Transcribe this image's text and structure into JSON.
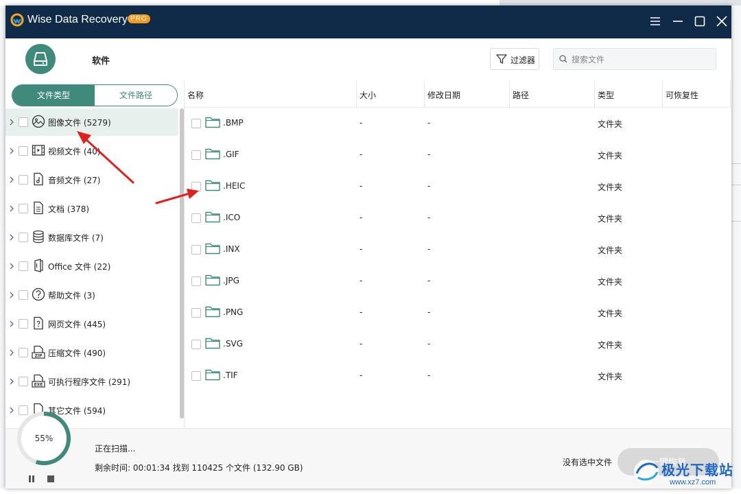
{
  "app": {
    "title": "Wise Data Recovery",
    "badge": "PRO"
  },
  "toolbar": {
    "drive_label": "软件",
    "filter_label": "过滤器",
    "search_placeholder": "搜索文件"
  },
  "sidebar": {
    "tabs": [
      {
        "label": "文件类型",
        "active": true
      },
      {
        "label": "文件路径",
        "active": false
      }
    ],
    "categories": [
      {
        "label": "图像文件 (5279)",
        "icon": "image-icon",
        "selected": true
      },
      {
        "label": "视频文件 (40)",
        "icon": "video-icon",
        "selected": false
      },
      {
        "label": "音频文件 (27)",
        "icon": "audio-icon",
        "selected": false
      },
      {
        "label": "文档 (378)",
        "icon": "document-icon",
        "selected": false
      },
      {
        "label": "数据库文件 (7)",
        "icon": "database-icon",
        "selected": false
      },
      {
        "label": "Office 文件 (22)",
        "icon": "office-icon",
        "selected": false
      },
      {
        "label": "帮助文件 (3)",
        "icon": "help-icon",
        "selected": false
      },
      {
        "label": "网页文件 (445)",
        "icon": "webpage-icon",
        "selected": false
      },
      {
        "label": "压缩文件 (490)",
        "icon": "zip-icon",
        "selected": false
      },
      {
        "label": "可执行程序文件 (291)",
        "icon": "exe-icon",
        "selected": false
      },
      {
        "label": "其它文件 (594)",
        "icon": "other-icon",
        "selected": false
      }
    ]
  },
  "table": {
    "columns": [
      "名称",
      "大小",
      "修改日期",
      "路径",
      "类型",
      "可恢复性"
    ],
    "rows": [
      {
        "name": ".BMP",
        "size": "-",
        "date": "-",
        "type": "文件夹"
      },
      {
        "name": ".GIF",
        "size": "-",
        "date": "-",
        "type": "文件夹"
      },
      {
        "name": ".HEIC",
        "size": "-",
        "date": "-",
        "type": "文件夹"
      },
      {
        "name": ".ICO",
        "size": "-",
        "date": "-",
        "type": "文件夹"
      },
      {
        "name": ".INX",
        "size": "-",
        "date": "-",
        "type": "文件夹"
      },
      {
        "name": ".JPG",
        "size": "-",
        "date": "-",
        "type": "文件夹"
      },
      {
        "name": ".PNG",
        "size": "-",
        "date": "-",
        "type": "文件夹"
      },
      {
        "name": ".SVG",
        "size": "-",
        "date": "-",
        "type": "文件夹"
      },
      {
        "name": ".TIF",
        "size": "-",
        "date": "-",
        "type": "文件夹"
      }
    ]
  },
  "scan": {
    "progress_percent": 55,
    "progress_label": "55%",
    "status": "正在扫描...",
    "detail": "剩余时间: 00:01:34 找到 110425 个文件 (132.90 GB)"
  },
  "footer": {
    "no_selection": "没有选中文件",
    "recover_label": "一键恢复"
  },
  "watermark": {
    "text": "极光下载站",
    "url": "www.xz7.com"
  },
  "colors": {
    "titlebar": "#0f2b47",
    "accent": "#3f8a7a",
    "badge": "#f59a23",
    "annotation_arrow": "#e0201c"
  }
}
